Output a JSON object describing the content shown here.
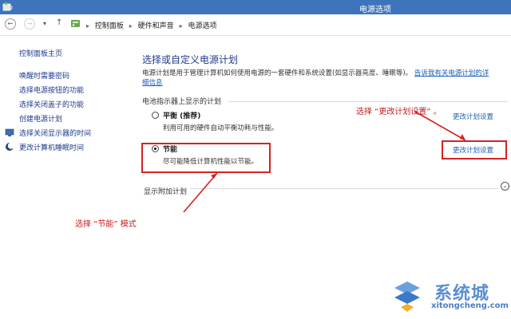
{
  "window": {
    "title": "电源选项"
  },
  "address": {
    "breadcrumbs": [
      "控制面板",
      "硬件和声音",
      "电源选项"
    ]
  },
  "sidebar": {
    "home": "控制面板主页",
    "links": [
      {
        "label": "唤醒时需要密码",
        "icon": null
      },
      {
        "label": "选择电源按钮的功能",
        "icon": null
      },
      {
        "label": "选择关闭盖子的功能",
        "icon": null
      },
      {
        "label": "创建电源计划",
        "icon": null
      },
      {
        "label": "选择关闭显示器的时间",
        "icon": "monitor-icon"
      },
      {
        "label": "更改计算机睡眠时间",
        "icon": "moon-icon"
      }
    ]
  },
  "main": {
    "heading": "选择或自定义电源计划",
    "description": "电源计划是用于管理计算机如何使用电源的一套硬件和系统设置(如显示器亮度、睡眠等)。",
    "more_link": "告诉我有关电源计划的详细信息",
    "section_label": "电池指示器上显示的计划",
    "plans": [
      {
        "name": "平衡 (推荐)",
        "desc": "利用可用的硬件自动平衡功耗与性能。",
        "selected": false,
        "link": "更改计划设置"
      },
      {
        "name": "节能",
        "desc": "尽可能降低计算机性能以节能。",
        "selected": true,
        "link": "更改计划设置"
      }
    ],
    "expander_label": "显示附加计划"
  },
  "annotations": {
    "top": "选择 “更改计划设置” 。",
    "bottom": "选择 “节能” 模式",
    "color": "#d62222"
  },
  "watermark": {
    "brand": "系统城",
    "url": "xitongcheng.com"
  },
  "colors": {
    "titlebar": "#3d74bb",
    "link": "#1e5fb5",
    "heading": "#1e3a8a"
  }
}
